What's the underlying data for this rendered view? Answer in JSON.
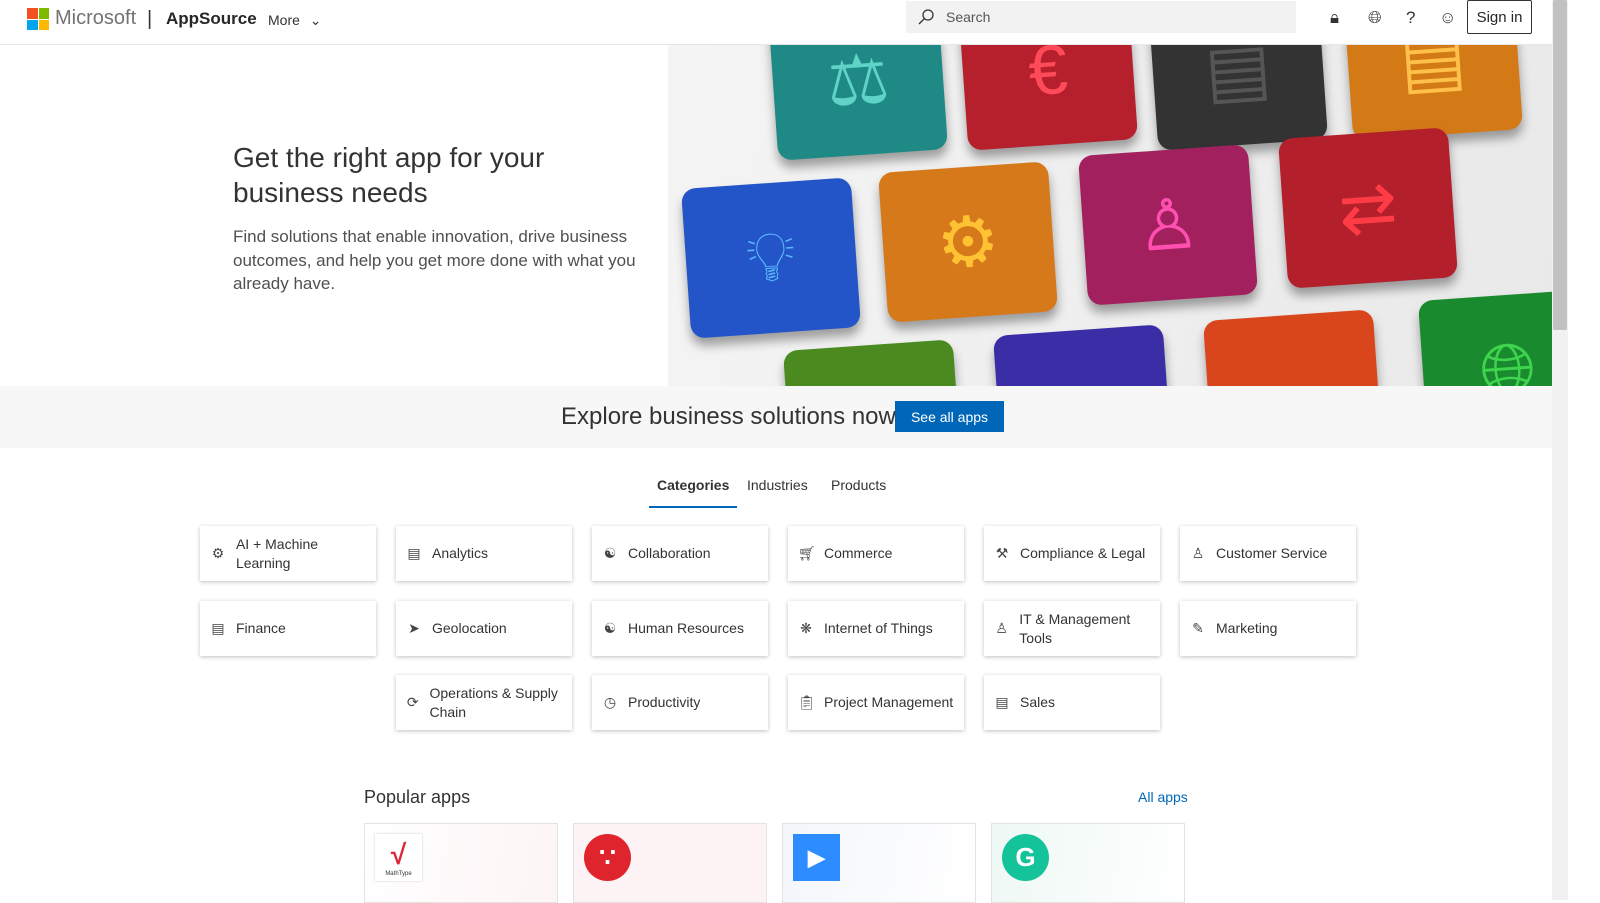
{
  "header": {
    "brand": "Microsoft",
    "product": "AppSource",
    "more": "More",
    "search_placeholder": "Search",
    "sign_in": "Sign in"
  },
  "hero": {
    "title": "Get the right app for your business needs",
    "description": "Find solutions that enable innovation, drive business outcomes, and help you get more done with what you already have."
  },
  "banner": {
    "text": "Explore business solutions now",
    "button": "See all apps"
  },
  "tabs": [
    "Categories",
    "Industries",
    "Products"
  ],
  "categories": [
    {
      "label": "AI + Machine Learning",
      "icon": "brain-icon"
    },
    {
      "label": "Analytics",
      "icon": "chart-icon"
    },
    {
      "label": "Collaboration",
      "icon": "people-icon"
    },
    {
      "label": "Commerce",
      "icon": "cart-icon"
    },
    {
      "label": "Compliance & Legal",
      "icon": "gavel-icon"
    },
    {
      "label": "Customer Service",
      "icon": "person-icon"
    },
    {
      "label": "Finance",
      "icon": "money-icon"
    },
    {
      "label": "Geolocation",
      "icon": "navigation-icon"
    },
    {
      "label": "Human Resources",
      "icon": "people-icon"
    },
    {
      "label": "Internet of Things",
      "icon": "network-icon"
    },
    {
      "label": "IT & Management Tools",
      "icon": "person-gear-icon"
    },
    {
      "label": "Marketing",
      "icon": "megaphone-icon"
    },
    {
      "label": "Operations & Supply Chain",
      "icon": "cycle-icon"
    },
    {
      "label": "Productivity",
      "icon": "gauge-icon"
    },
    {
      "label": "Project Management",
      "icon": "clipboard-icon"
    },
    {
      "label": "Sales",
      "icon": "bag-icon"
    }
  ],
  "popular": {
    "title": "Popular apps",
    "all": "All apps",
    "apps": [
      {
        "icon": "mathtype-logo",
        "logo_text": "MathType"
      },
      {
        "icon": "mendeley-logo"
      },
      {
        "icon": "zoom-logo"
      },
      {
        "icon": "grammarly-logo"
      }
    ]
  },
  "colors": {
    "accent": "#0067b8"
  }
}
